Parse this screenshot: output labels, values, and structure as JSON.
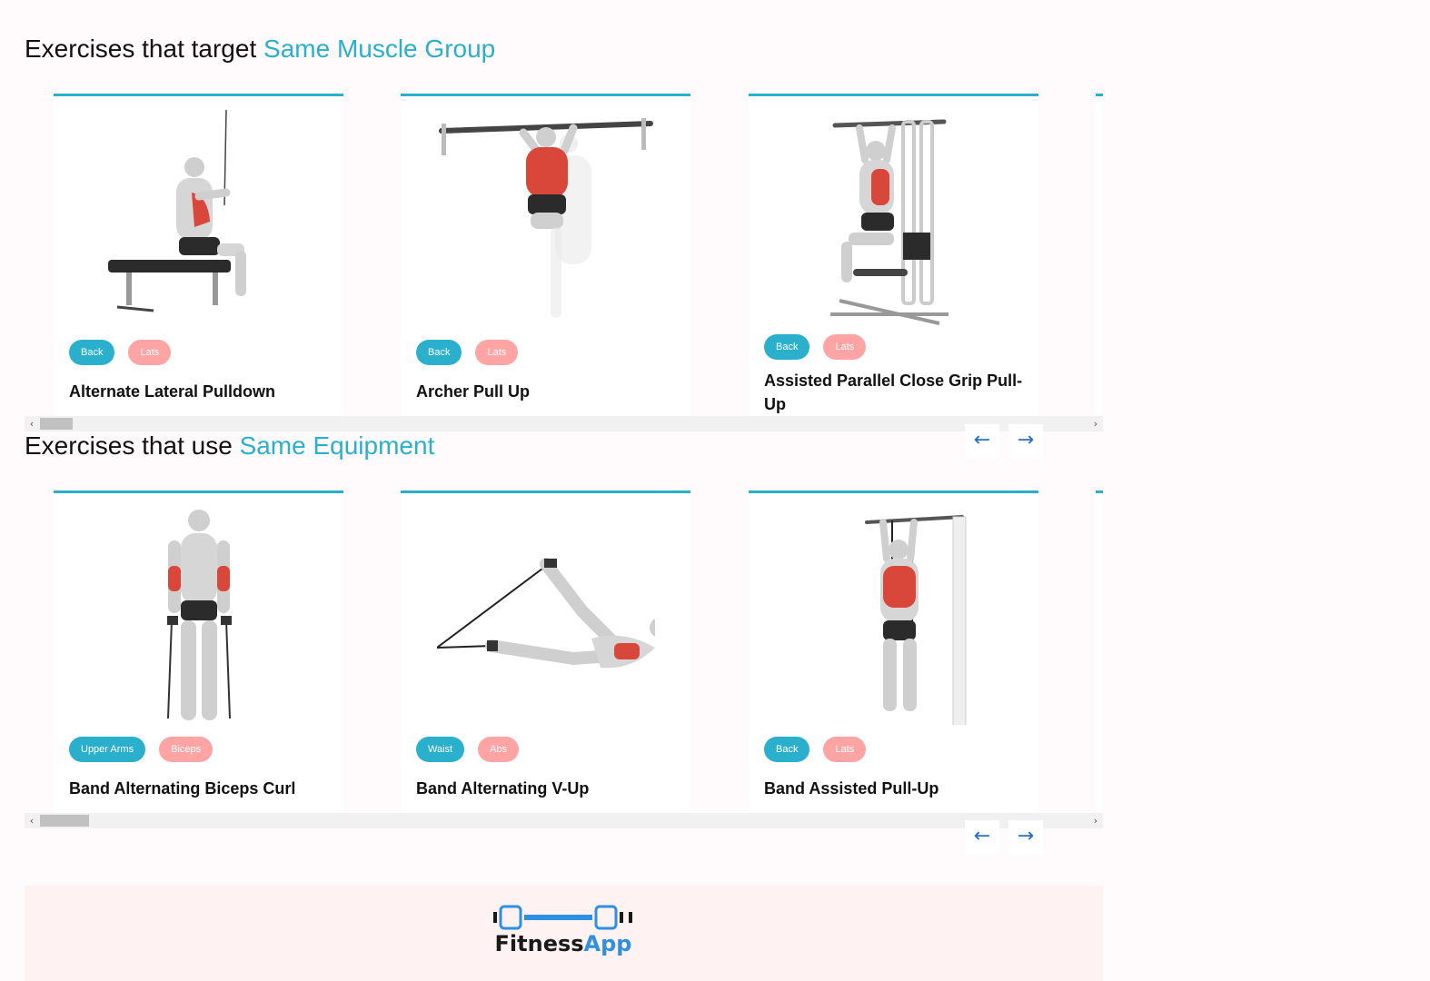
{
  "muscle_section": {
    "title_prefix": "Exercises that target ",
    "title_highlight": "Same Muscle Group",
    "cards": [
      {
        "name": "Alternate Lateral Pulldown",
        "tags": [
          "Back",
          "Lats"
        ]
      },
      {
        "name": "Archer Pull Up",
        "tags": [
          "Back",
          "Lats"
        ]
      },
      {
        "name": "Assisted Parallel Close Grip Pull-Up",
        "tags": [
          "Back",
          "Lats"
        ]
      }
    ]
  },
  "equipment_section": {
    "title_prefix": "Exercises that use ",
    "title_highlight": "Same Equipment",
    "cards": [
      {
        "name": "Band Alternating Biceps Curl",
        "tags": [
          "Upper Arms",
          "Biceps"
        ]
      },
      {
        "name": "Band Alternating V-Up",
        "tags": [
          "Waist",
          "Abs"
        ]
      },
      {
        "name": "Band Assisted Pull-Up",
        "tags": [
          "Back",
          "Lats"
        ]
      }
    ]
  },
  "nav": {
    "prev_icon": "←",
    "next_icon": "→"
  },
  "scroll_arrows": {
    "left": "‹",
    "right": "›"
  },
  "footer": {
    "logo_text_a": "Fitness",
    "logo_text_b": "App"
  },
  "colors": {
    "accent": "#2ab0cc",
    "tag_blue": "#2ab0cc",
    "tag_pink": "#ffa4a4",
    "nav_arrow": "#2a6fc0",
    "background": "#fffafb",
    "footer_bg": "#fff2f2"
  }
}
